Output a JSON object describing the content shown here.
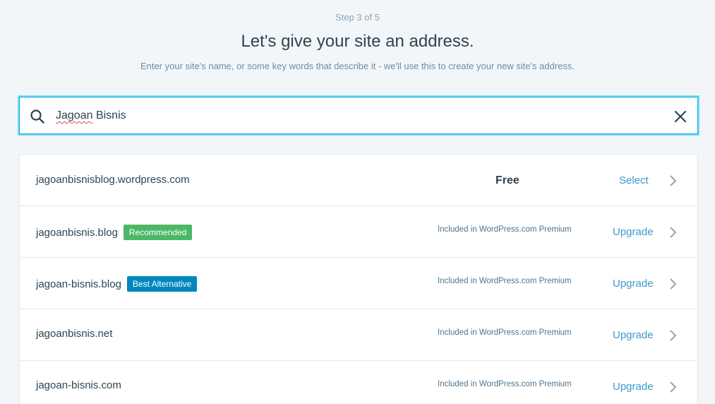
{
  "header": {
    "step": "Step 3 of 5",
    "title": "Let's give your site an address.",
    "subtitle": "Enter your site's name, or some key words that describe it - we'll use this to create your new site's address."
  },
  "search": {
    "value_typo": "Jagoan",
    "value_rest": " Bisnis",
    "icon": "search-icon",
    "clear_icon": "close-icon"
  },
  "results": [
    {
      "domain": "jagoanbisnisblog.wordpress.com",
      "badge": "",
      "price": "Free",
      "included": "",
      "action": "Select"
    },
    {
      "domain": "jagoanbisnis.blog",
      "badge": "Recommended",
      "badge_color": "#4ab866",
      "price": "",
      "included": "Included in WordPress.com Premium",
      "action": "Upgrade"
    },
    {
      "domain": "jagoan-bisnis.blog",
      "badge": "Best Alternative",
      "badge_color": "#0087be",
      "price": "",
      "included": "Included in WordPress.com Premium",
      "action": "Upgrade"
    },
    {
      "domain": "jagoanbisnis.net",
      "badge": "",
      "price": "",
      "included": "Included in WordPress.com Premium",
      "action": "Upgrade"
    },
    {
      "domain": "jagoan-bisnis.com",
      "badge": "",
      "price": "",
      "included": "Included in WordPress.com Premium",
      "action": "Upgrade"
    }
  ],
  "colors": {
    "background": "#f3f6f8",
    "accent": "#3d9acb",
    "focus_border": "#78dcfa",
    "recommended": "#4ab866",
    "best_alternative": "#0087be"
  }
}
